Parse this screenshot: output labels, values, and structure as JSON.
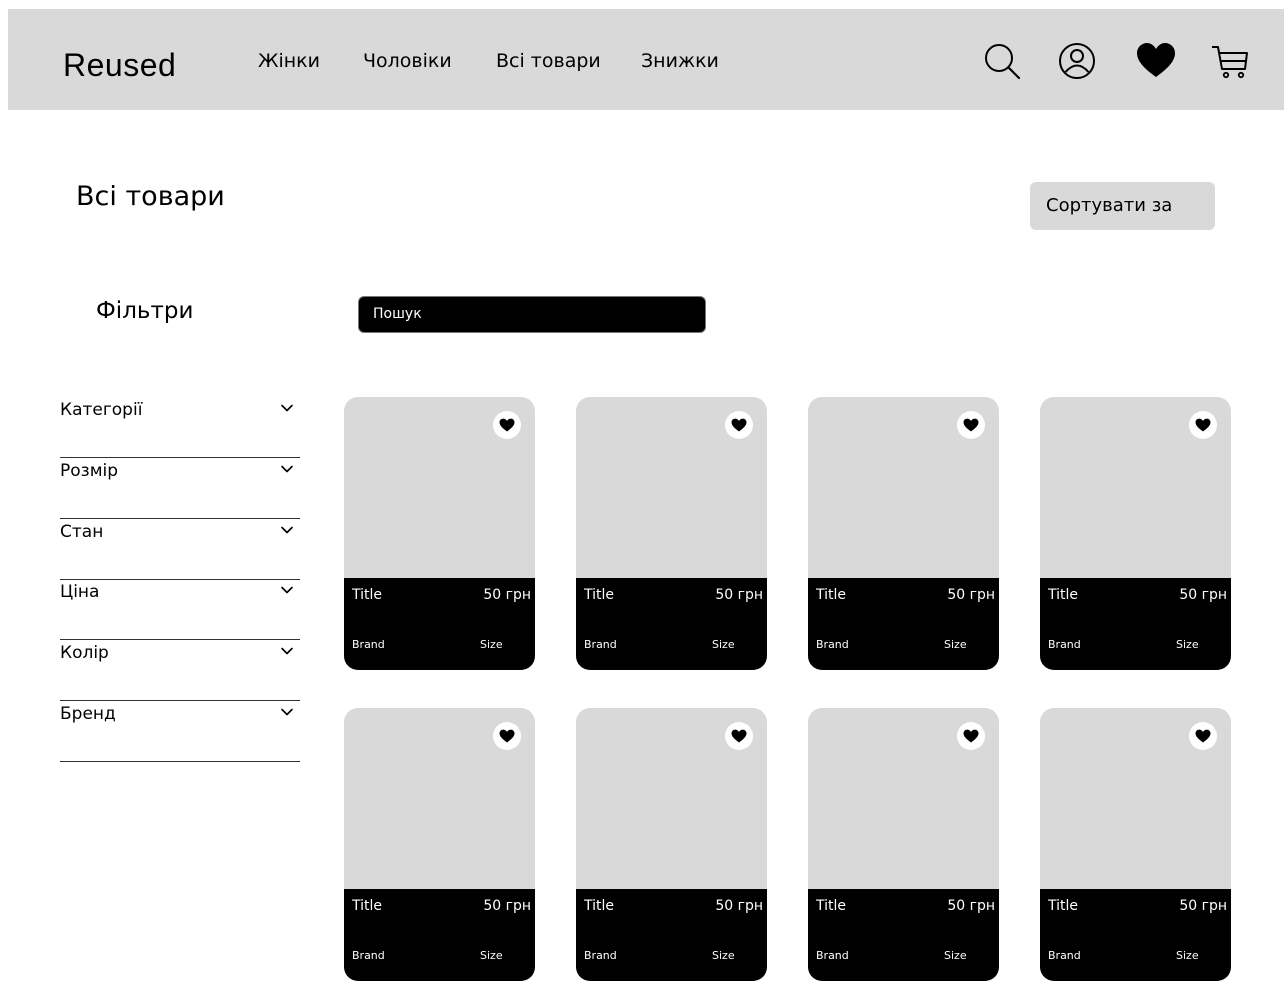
{
  "header": {
    "logo": "Reused",
    "nav": [
      "Жінки",
      "Чоловіки",
      "Всі товари",
      "Знижки"
    ],
    "icons": [
      "search-icon",
      "user-icon",
      "heart-icon",
      "cart-icon"
    ]
  },
  "page": {
    "title": "Всі товари",
    "sort_label": "Сортувати за"
  },
  "filters": {
    "title": "Фільтри",
    "items": [
      "Категорії",
      "Розмір",
      "Стан",
      "Ціна",
      "Колір",
      "Бренд"
    ]
  },
  "search": {
    "placeholder": "Пошук"
  },
  "products": [
    {
      "title": "Title",
      "price": "50 грн",
      "brand": "Brand",
      "size": "Size"
    },
    {
      "title": "Title",
      "price": "50 грн",
      "brand": "Brand",
      "size": "Size"
    },
    {
      "title": "Title",
      "price": "50 грн",
      "brand": "Brand",
      "size": "Size"
    },
    {
      "title": "Title",
      "price": "50 грн",
      "brand": "Brand",
      "size": "Size"
    },
    {
      "title": "Title",
      "price": "50 грн",
      "brand": "Brand",
      "size": "Size"
    },
    {
      "title": "Title",
      "price": "50 грн",
      "brand": "Brand",
      "size": "Size"
    },
    {
      "title": "Title",
      "price": "50 грн",
      "brand": "Brand",
      "size": "Size"
    },
    {
      "title": "Title",
      "price": "50 грн",
      "brand": "Brand",
      "size": "Size"
    }
  ],
  "colors": {
    "header_bg": "#d9d9d9",
    "card_bg": "#d9d9d9",
    "info_bg": "#000000"
  }
}
